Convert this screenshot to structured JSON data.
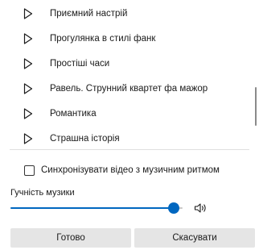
{
  "tracks": [
    {
      "label": "Приємний настрій",
      "icon": "play-outline-icon"
    },
    {
      "label": "Прогулянка в стилі фанк",
      "icon": "play-outline-icon"
    },
    {
      "label": "Простіші часи",
      "icon": "play-outline-icon"
    },
    {
      "label": "Равель. Струнний квартет фа мажор",
      "icon": "play-outline-icon"
    },
    {
      "label": "Романтика",
      "icon": "play-outline-icon"
    },
    {
      "label": "Страшна історія",
      "icon": "play-outline-icon"
    }
  ],
  "sync": {
    "label": "Синхронізувати відео з музичним ритмом",
    "checked": false
  },
  "volume": {
    "label": "Гучність музики",
    "level": 0.95,
    "icon": "speaker-icon"
  },
  "buttons": {
    "done": "Готово",
    "cancel": "Скасувати"
  },
  "colors": {
    "accent": "#0067c0",
    "button_bg": "#e5e5e5"
  }
}
